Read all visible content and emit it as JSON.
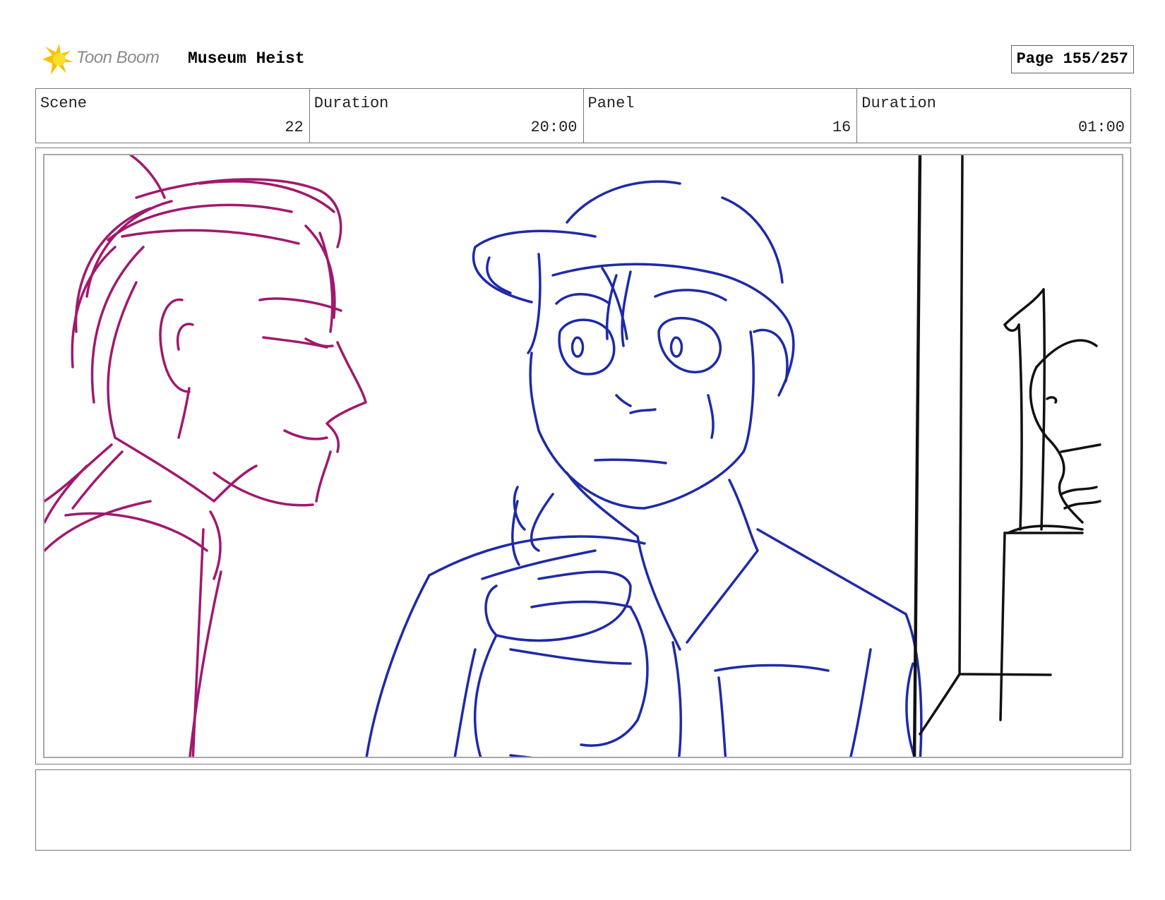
{
  "header": {
    "logo_text": "Toon Boom",
    "project_title": "Museum Heist",
    "page_label": "Page 155/257"
  },
  "info": {
    "scene_label": "Scene",
    "scene_value": "22",
    "scene_duration_label": "Duration",
    "scene_duration_value": "20:00",
    "panel_label": "Panel",
    "panel_value": "16",
    "panel_duration_label": "Duration",
    "panel_duration_value": "01:00"
  },
  "panel": {
    "colors": {
      "character_left": "#a0196e",
      "character_right": "#1e2aa8",
      "background": "#111111"
    }
  },
  "notes": {
    "text": ""
  }
}
